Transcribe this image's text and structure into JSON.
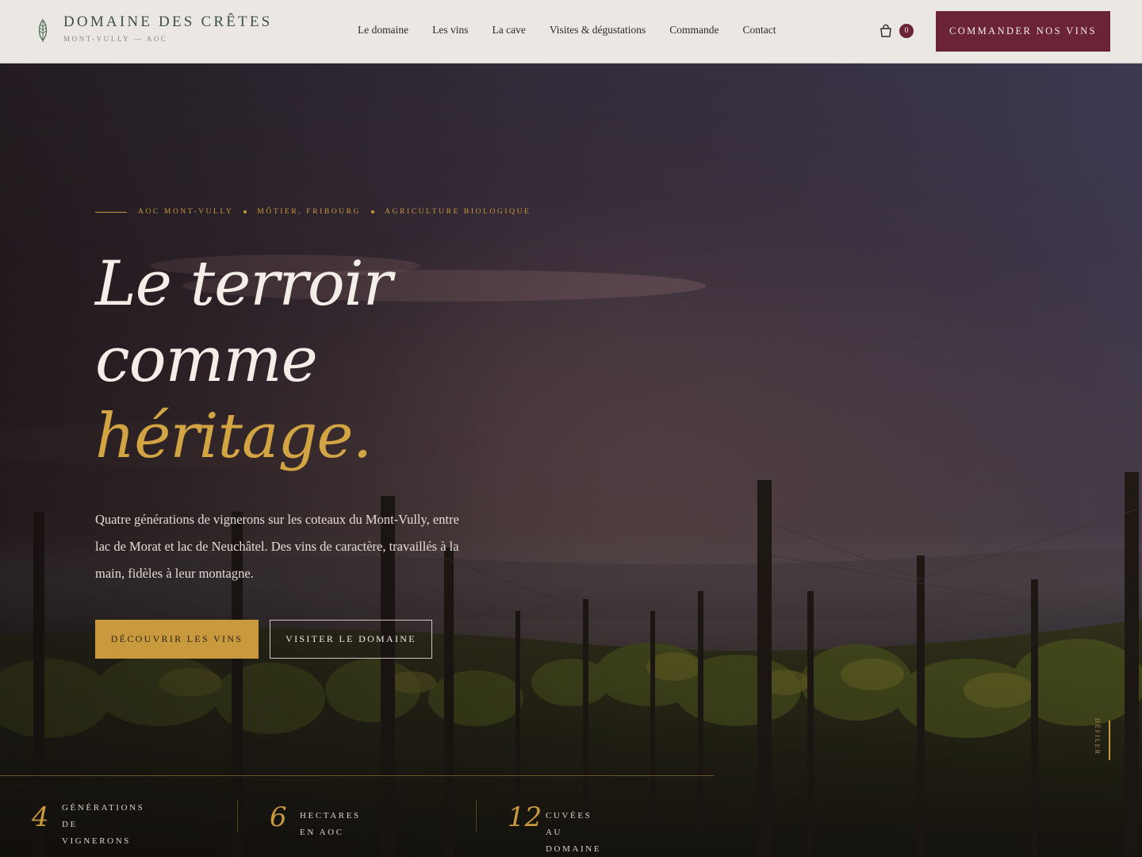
{
  "brand": {
    "name": "DOMAINE DES CRÊTES",
    "subtitle": "MONT-VULLY — AOC",
    "logo_icon": "leaf-icon"
  },
  "nav": {
    "items": [
      {
        "label": "Le domaine"
      },
      {
        "label": "Les vins"
      },
      {
        "label": "La cave"
      },
      {
        "label": "Visites & dégustations"
      },
      {
        "label": "Commande"
      },
      {
        "label": "Contact"
      }
    ]
  },
  "cart": {
    "icon": "shopping-bag-icon",
    "count": "0"
  },
  "header_cta": {
    "label": "COMMANDER NOS VINS"
  },
  "hero": {
    "eyebrow": [
      "AOC MONT-VULLY",
      "MÔTIER, FRIBOURG",
      "AGRICULTURE BIOLOGIQUE"
    ],
    "headline": {
      "line1": "Le terroir",
      "line2": "comme",
      "line3": "héritage."
    },
    "lead": "Quatre générations de vignerons sur les coteaux du Mont-Vully, entre lac de Morat et lac de Neuchâtel. Des vins de caractère, travaillés à la main, fidèles à leur montagne.",
    "primary_cta": "DÉCOUVRIR LES VINS",
    "secondary_cta": "VISITER LE DOMAINE",
    "scroll_label": "DÉFILER"
  },
  "stats": [
    {
      "value": "4",
      "label_line1": "GÉNÉRATIONS DE",
      "label_line2": "VIGNERONS"
    },
    {
      "value": "6",
      "label_line1": "HECTARES EN AOC",
      "label_line2": ""
    },
    {
      "value": "12",
      "label_line1": "CUVÉES AU DOMAINE",
      "label_line2": ""
    }
  ],
  "colors": {
    "burgundy": "#6b2436",
    "gold": "#c99a3d",
    "header_bg": "#ebe7e2",
    "brand_green": "#3f5242"
  }
}
